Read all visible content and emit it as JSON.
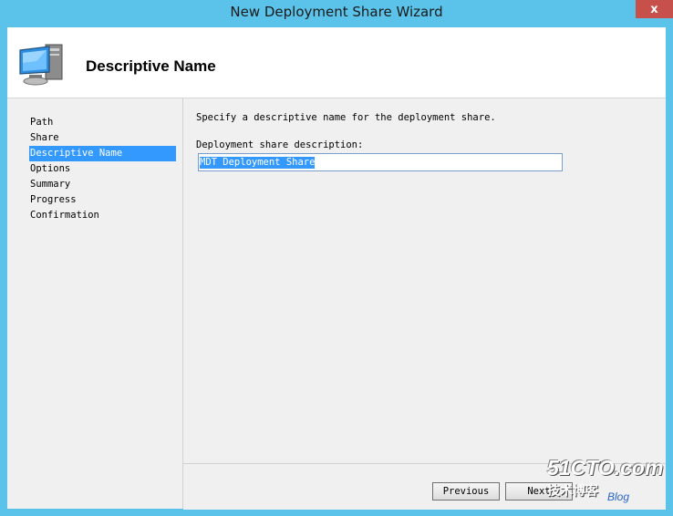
{
  "window": {
    "title": "New Deployment Share Wizard",
    "close_glyph": "x"
  },
  "header": {
    "title": "Descriptive Name",
    "icon": "computer-monitor-icon"
  },
  "sidebar": {
    "items": [
      {
        "label": "Path",
        "active": false
      },
      {
        "label": "Share",
        "active": false
      },
      {
        "label": "Descriptive Name",
        "active": true
      },
      {
        "label": "Options",
        "active": false
      },
      {
        "label": "Summary",
        "active": false
      },
      {
        "label": "Progress",
        "active": false
      },
      {
        "label": "Confirmation",
        "active": false
      }
    ]
  },
  "main": {
    "instruction": "Specify a descriptive name for the deployment share.",
    "field_label": "Deployment share description:",
    "field_value": "MDT Deployment Share"
  },
  "footer": {
    "previous_label": "Previous",
    "next_label": "Next"
  },
  "watermark": {
    "site": "51CTO.com",
    "tagline": "技术博客",
    "blog": "Blog"
  },
  "colors": {
    "window_frame": "#5bc3ea",
    "selection": "#3399ff",
    "close_button": "#c7504a"
  }
}
